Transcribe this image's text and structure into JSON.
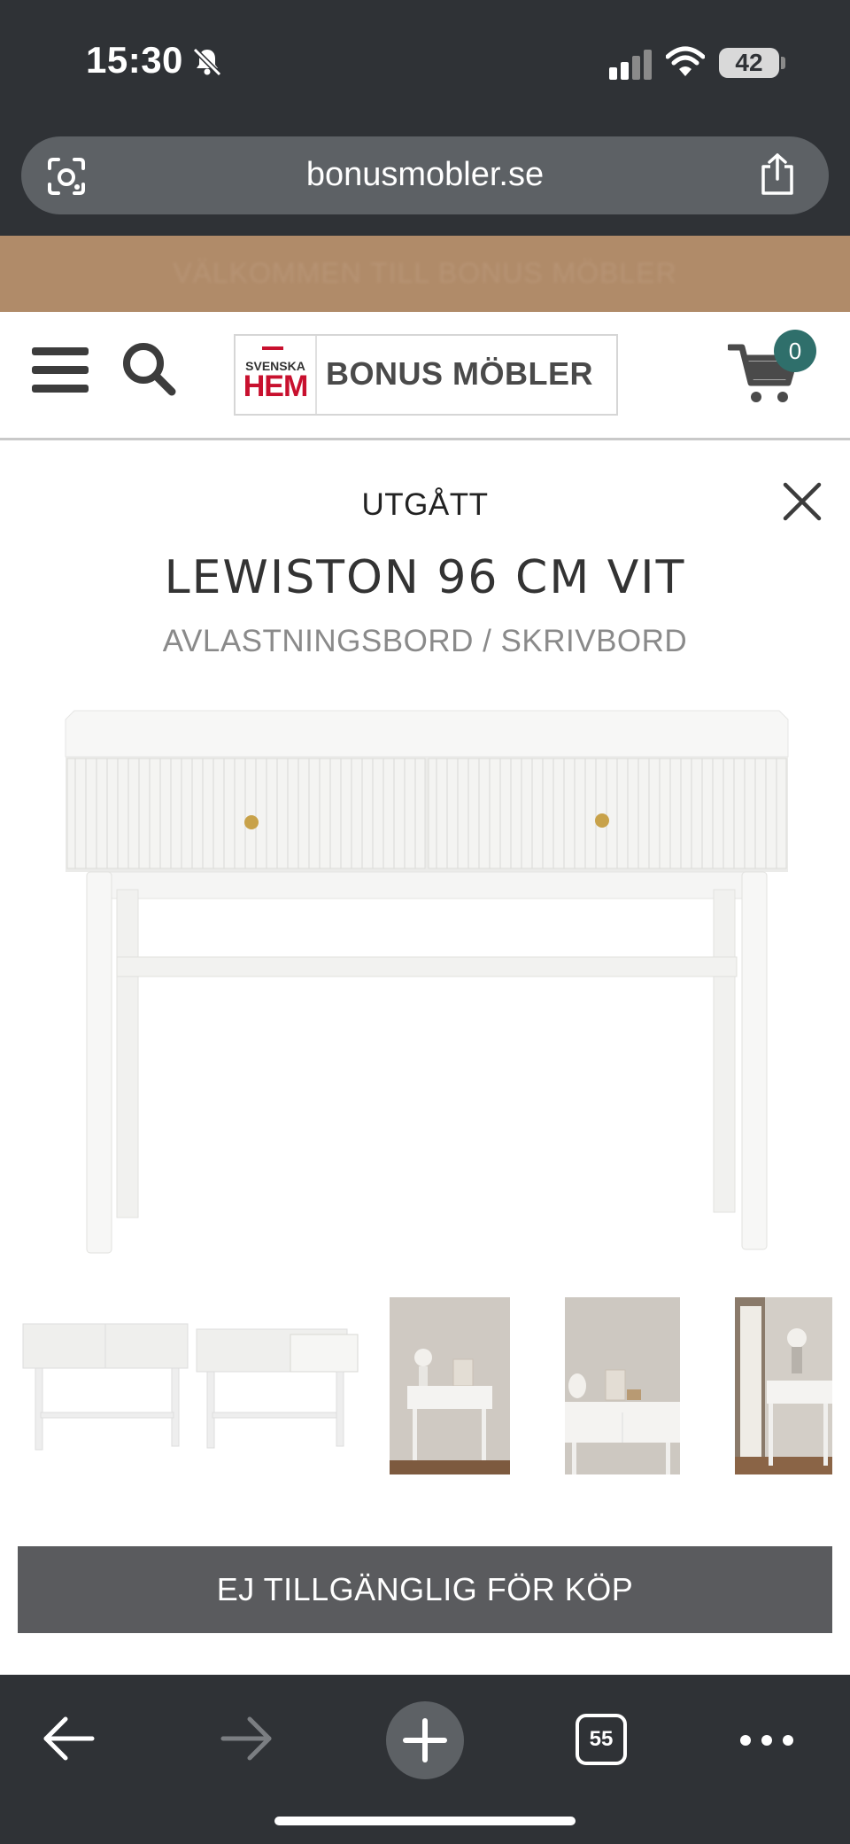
{
  "status_bar": {
    "time": "15:30",
    "battery": "42"
  },
  "browser": {
    "url": "bonusmobler.se",
    "tab_count": "55"
  },
  "promo": {
    "text": "VÄLKOMMEN TILL BONUS MÖBLER"
  },
  "header": {
    "logo": {
      "small": "SVENSKA",
      "hem": "HEM",
      "name": "BONUS MÖBLER"
    },
    "cart_count": "0"
  },
  "product": {
    "status": "UTGÅTT",
    "title": "LEWISTON 96 CM VIT",
    "subtitle": "AVLASTNINGSBORD / SKRIVBORD",
    "button": "EJ TILLGÄNGLIG FÖR KÖP"
  },
  "icons": [
    "camera-lens-icon",
    "share-icon",
    "hamburger-menu-icon",
    "search-icon",
    "cart-icon",
    "close-icon",
    "back-arrow-icon",
    "forward-arrow-icon",
    "plus-icon",
    "tabs-icon",
    "more-icon"
  ],
  "colors": {
    "promo": "#b08b69",
    "badge": "#2f6f6b",
    "button": "#5a5b5e",
    "chrome": "#2f3236"
  }
}
